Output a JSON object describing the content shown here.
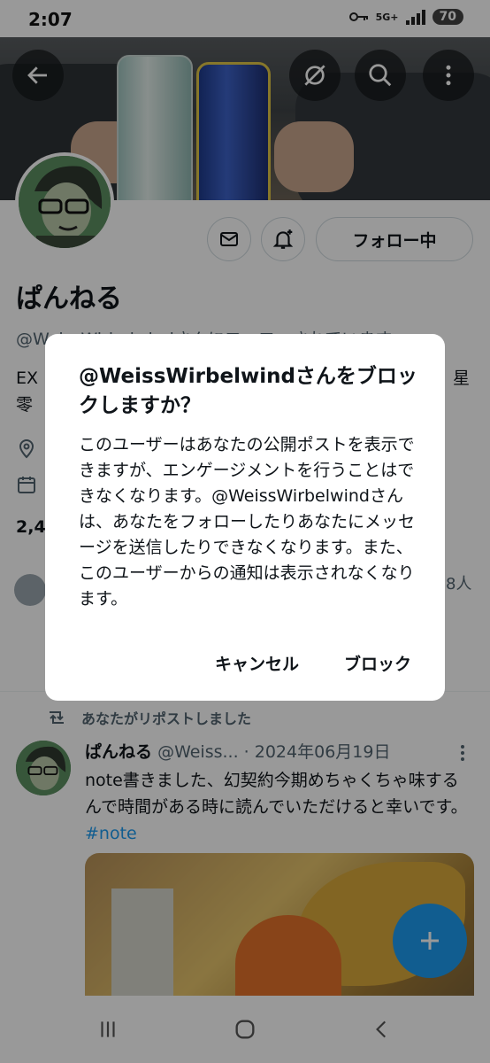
{
  "status_bar": {
    "time": "2:07",
    "network": "5G+",
    "battery": "70"
  },
  "profile": {
    "name": "ぱんねる",
    "handle_partial": "@WeissWirbelwindさんにフォローされています",
    "bio_left": "EX\n零",
    "bio_right": "星",
    "stats_partial": "2,4",
    "followers_right": "8人",
    "follow_button": "フォロー中"
  },
  "timeline": {
    "repost_label": "あなたがリポストしました",
    "tweet": {
      "name": "ぱんねる",
      "handle": "@Weiss...",
      "date": "· 2024年06月19日",
      "text": "note書きました、幻契約今期めちゃくちゃ味するんで時間がある時に読んでいただけると幸いです。",
      "hashtag": "#note"
    }
  },
  "dialog": {
    "title": "@WeissWirbelwindさんをブロックしますか？",
    "body": "このユーザーはあなたの公開ポストを表示できますが、エンゲージメントを行うことはできなくなります。@WeissWirbelwindさんは、あなたをフォローしたりあなたにメッセージを送信したりできなくなります。また、このユーザーからの通知は表示されなくなります。",
    "cancel": "キャンセル",
    "confirm": "ブロック"
  },
  "colors": {
    "accent": "#1d9bf0",
    "text": "#0f1419",
    "secondary": "#536471",
    "scrim": "rgba(0,0,0,0.4)"
  },
  "icons": [
    "back-arrow-icon",
    "eye-off-icon",
    "search-icon",
    "more-vertical-icon",
    "mail-icon",
    "bell-plus-icon",
    "location-icon",
    "calendar-icon",
    "repost-icon",
    "plus-icon",
    "recents-icon",
    "home-icon",
    "back-icon"
  ]
}
